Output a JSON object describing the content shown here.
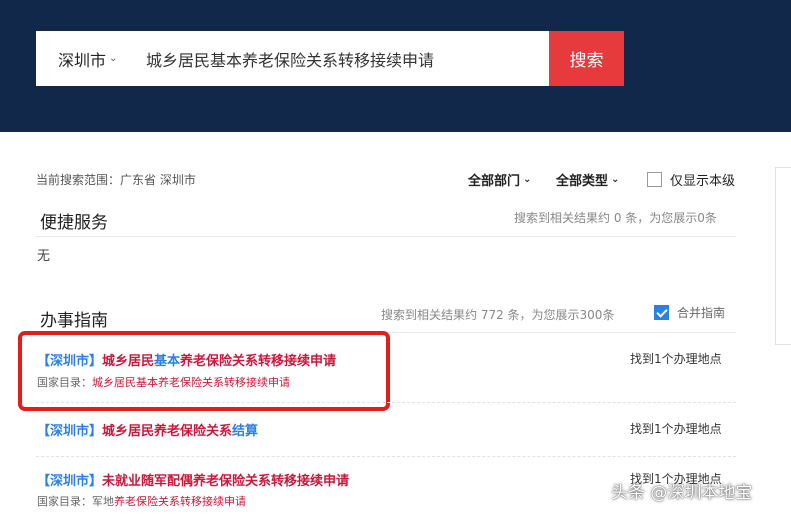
{
  "search": {
    "city": "深圳市",
    "query": "城乡居民基本养老保险关系转移接续申请",
    "button_label": "搜索"
  },
  "filters": {
    "scope_label": "当前搜索范围：广东省 深圳市",
    "department": "全部部门",
    "type": "全部类型",
    "only_this_level": "仅显示本级"
  },
  "quick_services": {
    "title": "便捷服务",
    "meta": "搜索到相关结果约 0 条，为您展示0条",
    "empty_text": "无"
  },
  "guides": {
    "title": "办事指南",
    "meta": "搜索到相关结果约 772 条，为您展示300条",
    "merge_label": "合并指南",
    "merge_checked": true,
    "results": [
      {
        "prefix": "【深圳市】",
        "title_a": "城乡居民",
        "title_b": "基本",
        "title_c": "养老保险关系转移接续申请",
        "catalog_label": "国家目录：",
        "catalog_value": "城乡居民基本养老保险关系转移接续申请",
        "location": "找到1个办理地点"
      },
      {
        "prefix": "【深圳市】",
        "title_a": "城乡居民养老保险关系",
        "title_b": "结算",
        "location": "找到1个办理地点"
      },
      {
        "prefix": "【深圳市】",
        "title_a": "未就业随军配偶",
        "title_b": "养老保险关系转移接续申请",
        "catalog_label": "国家目录：",
        "catalog_value_a": "军地",
        "catalog_value_b": "养老保险关系转移接续申请",
        "location": "找到1个办理地点"
      }
    ]
  },
  "watermark": "头条 @深圳本地宝",
  "colors": {
    "header_bg": "#12284b",
    "search_button": "#e73a3c",
    "link_blue": "#2d7fe0",
    "highlight_red": "#c8193c",
    "annotation_box": "#e61c1c"
  },
  "icons": [
    "chevron-down-icon",
    "checkbox-icon"
  ]
}
